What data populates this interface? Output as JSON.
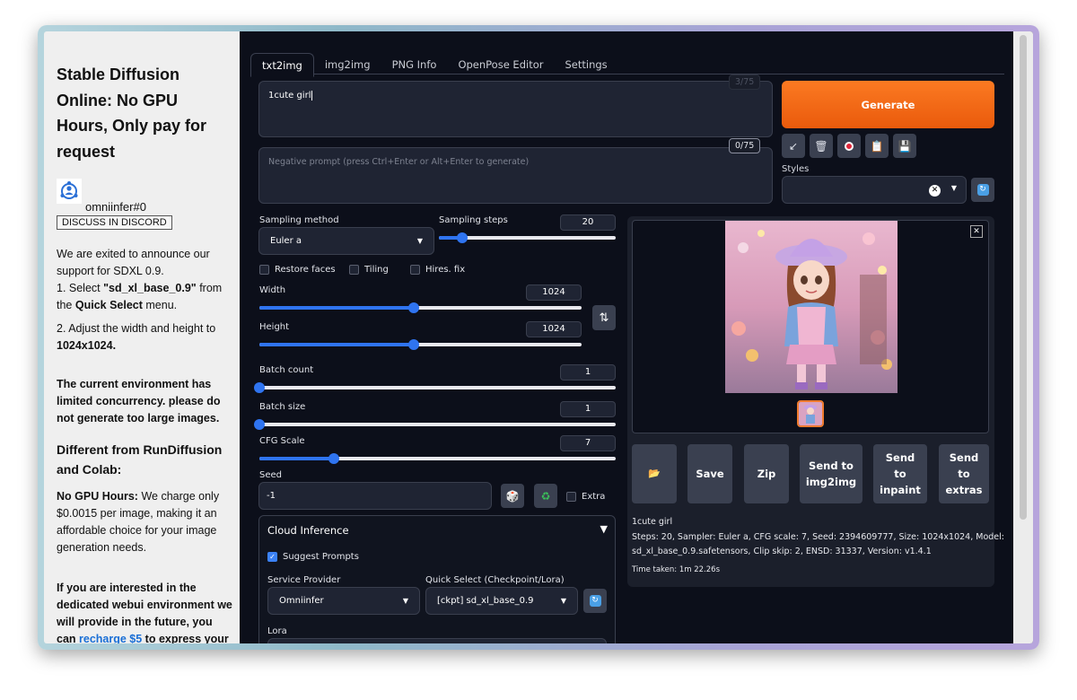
{
  "sidebar": {
    "title": "Stable Diffusion Online: No GPU Hours, Only pay for request",
    "username": "omniinfer#0",
    "discord_button": "DISCUSS IN DISCORD",
    "announce": "We are exited to announce our support for SDXL 0.9.",
    "step1_prefix": "1. Select ",
    "step1_model": "\"sd_xl_base_0.9\"",
    "step1_mid": " from the ",
    "step1_menu": "Quick Select",
    "step1_suffix": " menu.",
    "step2_prefix": "2. Adjust the width and height to ",
    "step2_size": "1024x1024.",
    "concurrency": "The current environment has limited concurrency. please do not generate too large images.",
    "diff_heading": "Different from RunDiffusion and Colab:",
    "nogpu_label": "No GPU Hours:",
    "nogpu_text": " We charge only $0.0015 per image, making it an affordable choice for your image generation needs.",
    "interest_text": "If you are interested in the dedicated webui environment we will provide in the future, you can ",
    "recharge_link": "recharge $5",
    "interest_suffix": " to express your"
  },
  "tabs": [
    "txt2img",
    "img2img",
    "PNG Info",
    "OpenPose Editor",
    "Settings"
  ],
  "prompt": {
    "value": "1cute girl",
    "token_counter_faded": "3/75",
    "negative_placeholder": "Negative prompt (press Ctrl+Enter or Alt+Enter to generate)",
    "negative_counter": "0/75"
  },
  "generate_label": "Generate",
  "styles_label": "Styles",
  "sampling": {
    "method_label": "Sampling method",
    "method_value": "Euler a",
    "steps_label": "Sampling steps",
    "steps_value": "20",
    "steps_fraction": 0.13
  },
  "checkboxes": {
    "restore_faces": "Restore faces",
    "tiling": "Tiling",
    "hires_fix": "Hires. fix",
    "extra": "Extra",
    "suggest_prompts": "Suggest Prompts"
  },
  "width": {
    "label": "Width",
    "value": "1024",
    "fraction": 0.48
  },
  "height": {
    "label": "Height",
    "value": "1024",
    "fraction": 0.48
  },
  "batch_count": {
    "label": "Batch count",
    "value": "1",
    "fraction": 0.0
  },
  "batch_size": {
    "label": "Batch size",
    "value": "1",
    "fraction": 0.0
  },
  "cfg_scale": {
    "label": "CFG Scale",
    "value": "7",
    "fraction": 0.21
  },
  "seed": {
    "label": "Seed",
    "value": "-1"
  },
  "cloud": {
    "title": "Cloud Inference",
    "service_label": "Service Provider",
    "service_value": "Omniinfer",
    "quick_label": "Quick Select (Checkpoint/Lora)",
    "quick_value": "[ckpt] sd_xl_base_0.9",
    "lora_label": "Lora"
  },
  "output_buttons": {
    "folder": "📂",
    "save": "Save",
    "zip": "Zip",
    "send_img2img": "Send to img2img",
    "send_inpaint": "Send to inpaint",
    "send_extras": "Send to extras"
  },
  "info": {
    "prompt": "1cute girl",
    "params1": "Steps: 20, Sampler: Euler a, CFG scale: 7, Seed: 2394609777, Size: 1024x1024, Model:",
    "params2": "sd_xl_base_0.9.safetensors, Clip skip: 2, ENSD: 31337, Version: v1.4.1",
    "time": "Time taken: 1m 22.26s"
  },
  "colors": {
    "accent_orange": "#f07b2e",
    "slider_blue": "#2f74f0",
    "bg_dark": "#0c0f1a",
    "link_blue": "#1a6fd6"
  },
  "icons": [
    "person-network-logo-icon",
    "arrow-icon",
    "trash-icon",
    "red-button-icon",
    "clipboard-icon",
    "save-icon",
    "refresh-icon",
    "swap-icon",
    "dice-icon",
    "recycle-icon",
    "close-icon",
    "folder-icon"
  ]
}
